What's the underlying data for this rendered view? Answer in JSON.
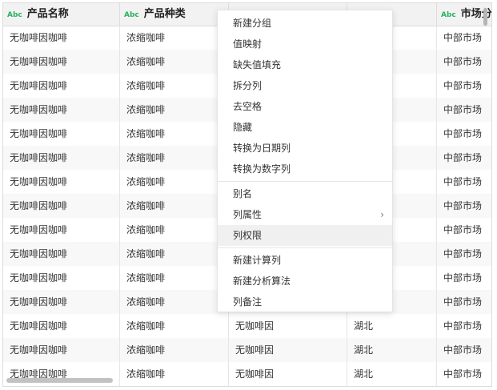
{
  "columns": [
    {
      "type": "Abc",
      "name": "产品名称"
    },
    {
      "type": "Abc",
      "name": "产品种类"
    },
    {
      "type": "",
      "name": ""
    },
    {
      "type": "",
      "name": ""
    },
    {
      "type": "Abc",
      "name": "市场分布"
    }
  ],
  "rows": [
    [
      "无咖啡因咖啡",
      "浓缩咖啡",
      "",
      "",
      "中部市场"
    ],
    [
      "无咖啡因咖啡",
      "浓缩咖啡",
      "",
      "",
      "中部市场"
    ],
    [
      "无咖啡因咖啡",
      "浓缩咖啡",
      "",
      "",
      "中部市场"
    ],
    [
      "无咖啡因咖啡",
      "浓缩咖啡",
      "",
      "",
      "中部市场"
    ],
    [
      "无咖啡因咖啡",
      "浓缩咖啡",
      "",
      "",
      "中部市场"
    ],
    [
      "无咖啡因咖啡",
      "浓缩咖啡",
      "",
      "",
      "中部市场"
    ],
    [
      "无咖啡因咖啡",
      "浓缩咖啡",
      "",
      "",
      "中部市场"
    ],
    [
      "无咖啡因咖啡",
      "浓缩咖啡",
      "",
      "",
      "中部市场"
    ],
    [
      "无咖啡因咖啡",
      "浓缩咖啡",
      "",
      "",
      "中部市场"
    ],
    [
      "无咖啡因咖啡",
      "浓缩咖啡",
      "",
      "",
      "中部市场"
    ],
    [
      "无咖啡因咖啡",
      "浓缩咖啡",
      "",
      "",
      "中部市场"
    ],
    [
      "无咖啡因咖啡",
      "浓缩咖啡",
      "",
      "",
      "中部市场"
    ],
    [
      "无咖啡因咖啡",
      "浓缩咖啡",
      "无咖啡因",
      "湖北",
      "中部市场"
    ],
    [
      "无咖啡因咖啡",
      "浓缩咖啡",
      "无咖啡因",
      "湖北",
      "中部市场"
    ],
    [
      "无咖啡因咖啡",
      "浓缩咖啡",
      "无咖啡因",
      "湖北",
      "中部市场"
    ]
  ],
  "context_menu": {
    "groups": [
      [
        {
          "label": "新建分组"
        },
        {
          "label": "值映射"
        },
        {
          "label": "缺失值填充"
        },
        {
          "label": "拆分列"
        },
        {
          "label": "去空格"
        },
        {
          "label": "隐藏"
        },
        {
          "label": "转换为日期列"
        },
        {
          "label": "转换为数字列"
        }
      ],
      [
        {
          "label": "别名"
        },
        {
          "label": "列属性",
          "submenu": true
        },
        {
          "label": "列权限",
          "hover": true
        }
      ],
      [
        {
          "label": "新建计算列"
        },
        {
          "label": "新建分析算法"
        },
        {
          "label": "列备注"
        }
      ]
    ]
  },
  "icons": {
    "submenu": "chevron-right-icon",
    "column_type": "text-type-icon"
  },
  "colors": {
    "type_tag": "#2bb15f",
    "hover": "#f0f0f0"
  }
}
